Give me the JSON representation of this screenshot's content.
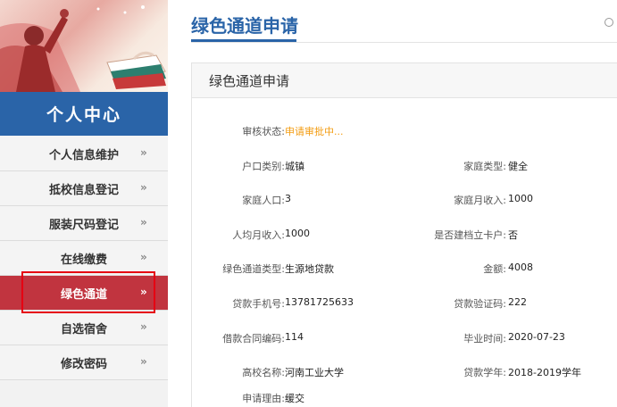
{
  "sidebar": {
    "title": "个人中心",
    "items": [
      {
        "label": "个人信息维护"
      },
      {
        "label": "抵校信息登记"
      },
      {
        "label": "服装尺码登记"
      },
      {
        "label": "在线缴费"
      },
      {
        "label": "绿色通道"
      },
      {
        "label": "自选宿舍"
      },
      {
        "label": "修改密码"
      }
    ],
    "active_index": 4,
    "chevron": "»"
  },
  "main": {
    "page_title": "绿色通道申请",
    "panel_title": "绿色通道申请",
    "fields": {
      "status": {
        "label": "审核状态:",
        "value": "申请审批中..."
      },
      "hukou": {
        "label": "户口类别:",
        "value": "城镇"
      },
      "family_type": {
        "label": "家庭类型:",
        "value": "健全"
      },
      "family_size": {
        "label": "家庭人口:",
        "value": "3"
      },
      "family_income": {
        "label": "家庭月收入:",
        "value": "1000"
      },
      "per_income": {
        "label": "人均月收入:",
        "value": "1000"
      },
      "poor_card": {
        "label": "是否建档立卡户:",
        "value": "否"
      },
      "channel_type": {
        "label": "绿色通道类型:",
        "value": "生源地贷款"
      },
      "amount": {
        "label": "金额:",
        "value": "4008"
      },
      "loan_phone": {
        "label": "贷款手机号:",
        "value": "13781725633"
      },
      "loan_code": {
        "label": "贷款验证码:",
        "value": "222"
      },
      "contract_no": {
        "label": "借款合同编码:",
        "value": "114"
      },
      "grad_time": {
        "label": "毕业时间:",
        "value": "2020-07-23"
      },
      "college": {
        "label": "高校名称:",
        "value": "河南工业大学"
      },
      "loan_year": {
        "label": "贷款学年:",
        "value": "2018-2019学年"
      },
      "reason": {
        "label": "申请理由:",
        "value": "缓交"
      }
    }
  },
  "colors": {
    "brand_blue": "#2a64a8",
    "active_red": "#c1343f",
    "pending_orange": "#f39c12",
    "highlight_red": "#e50012"
  }
}
